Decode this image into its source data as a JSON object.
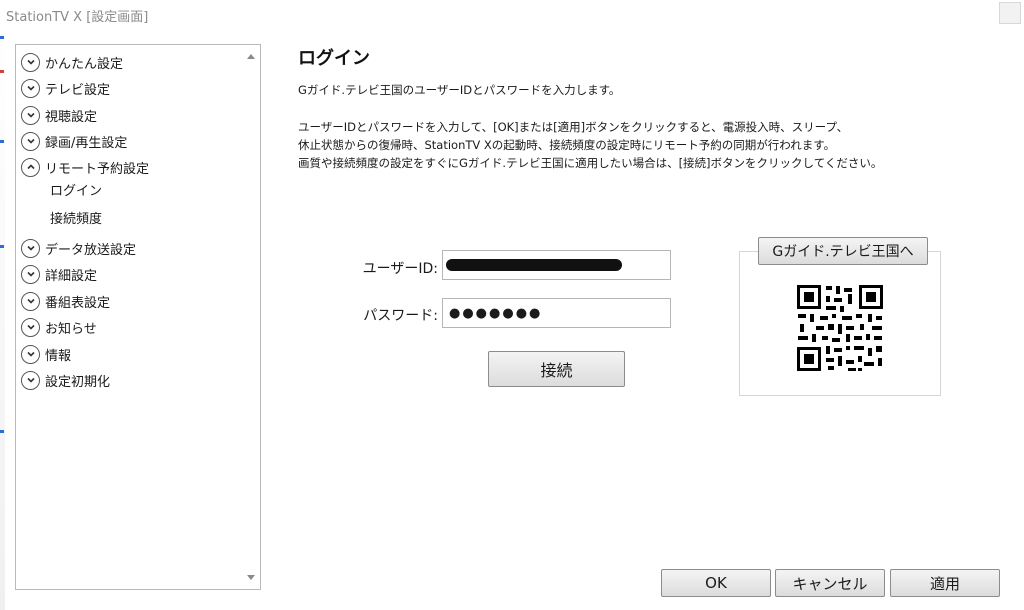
{
  "window": {
    "title": "StationTV X [設定画面]"
  },
  "sidebar": {
    "items": [
      {
        "label": "かんたん設定",
        "state": "collapsed"
      },
      {
        "label": "テレビ設定",
        "state": "collapsed"
      },
      {
        "label": "視聴設定",
        "state": "collapsed"
      },
      {
        "label": "録画/再生設定",
        "state": "collapsed"
      },
      {
        "label": "リモート予約設定",
        "state": "expanded"
      },
      {
        "label": "データ放送設定",
        "state": "collapsed"
      },
      {
        "label": "詳細設定",
        "state": "collapsed"
      },
      {
        "label": "番組表設定",
        "state": "collapsed"
      },
      {
        "label": "お知らせ",
        "state": "collapsed"
      },
      {
        "label": "情報",
        "state": "collapsed"
      },
      {
        "label": "設定初期化",
        "state": "collapsed"
      }
    ],
    "subitems": [
      "ログイン",
      "接続頻度"
    ]
  },
  "main": {
    "title": "ログイン",
    "intro": "Gガイド.テレビ王国のユーザーIDとパスワードを入力します。",
    "desc": [
      "ユーザーIDとパスワードを入力して、[OK]または[適用]ボタンをクリックすると、電源投入時、スリープ、",
      "休止状態からの復帰時、StationTV Xの起動時、接続頻度の設定時にリモート予約の同期が行われます。",
      "画質や接続頻度の設定をすぐにGガイド.テレビ王国に適用したい場合は、[接続]ボタンをクリックしてください。"
    ],
    "user_label": "ユーザーID:",
    "user_value": "",
    "password_label": "パスワード:",
    "password_value": "●●●●●●●",
    "connect_label": "接続",
    "gguide_label": "Gガイド.テレビ王国へ"
  },
  "footer": {
    "ok": "OK",
    "cancel": "キャンセル",
    "apply": "適用"
  },
  "colors": {
    "button_border": "#8c8c8c",
    "panel_border": "#b9b9b9",
    "title_gray": "#8a8a8a"
  },
  "icons": [
    "chevron-down-icon",
    "chevron-up-icon",
    "qr-code-icon",
    "close-icon"
  ]
}
